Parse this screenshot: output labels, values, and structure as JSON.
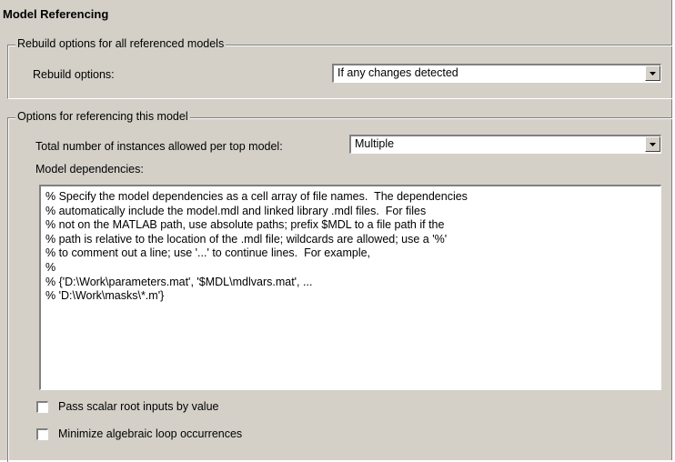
{
  "title": "Model Referencing",
  "rebuild_group": {
    "legend": "Rebuild options for all referenced models",
    "label": "Rebuild options:",
    "value": "If any changes detected"
  },
  "options_group": {
    "legend": "Options for referencing this model",
    "instances_label": "Total number of instances allowed per top model:",
    "instances_value": "Multiple",
    "dependencies_label": "Model dependencies:",
    "dependencies_text": [
      "% Specify the model dependencies as a cell array of file names.  The dependencies",
      "% automatically include the model.mdl and linked library .mdl files.  For files",
      "% not on the MATLAB path, use absolute paths; prefix $MDL to a file path if the",
      "% path is relative to the location of the .mdl file; wildcards are allowed; use a '%'",
      "% to comment out a line; use '...' to continue lines.  For example,",
      "%",
      "% {'D:\\Work\\parameters.mat', '$MDL\\mdlvars.mat', ...",
      "% 'D:\\Work\\masks\\*.m'}"
    ],
    "checkboxes": [
      {
        "label": "Pass scalar root inputs by value",
        "checked": false
      },
      {
        "label": "Minimize algebraic loop occurrences",
        "checked": false
      }
    ]
  },
  "icons": {
    "dropdown": "chevron-down-icon"
  },
  "colors": {
    "panel": "#d4d0c8",
    "field": "#ffffff"
  }
}
